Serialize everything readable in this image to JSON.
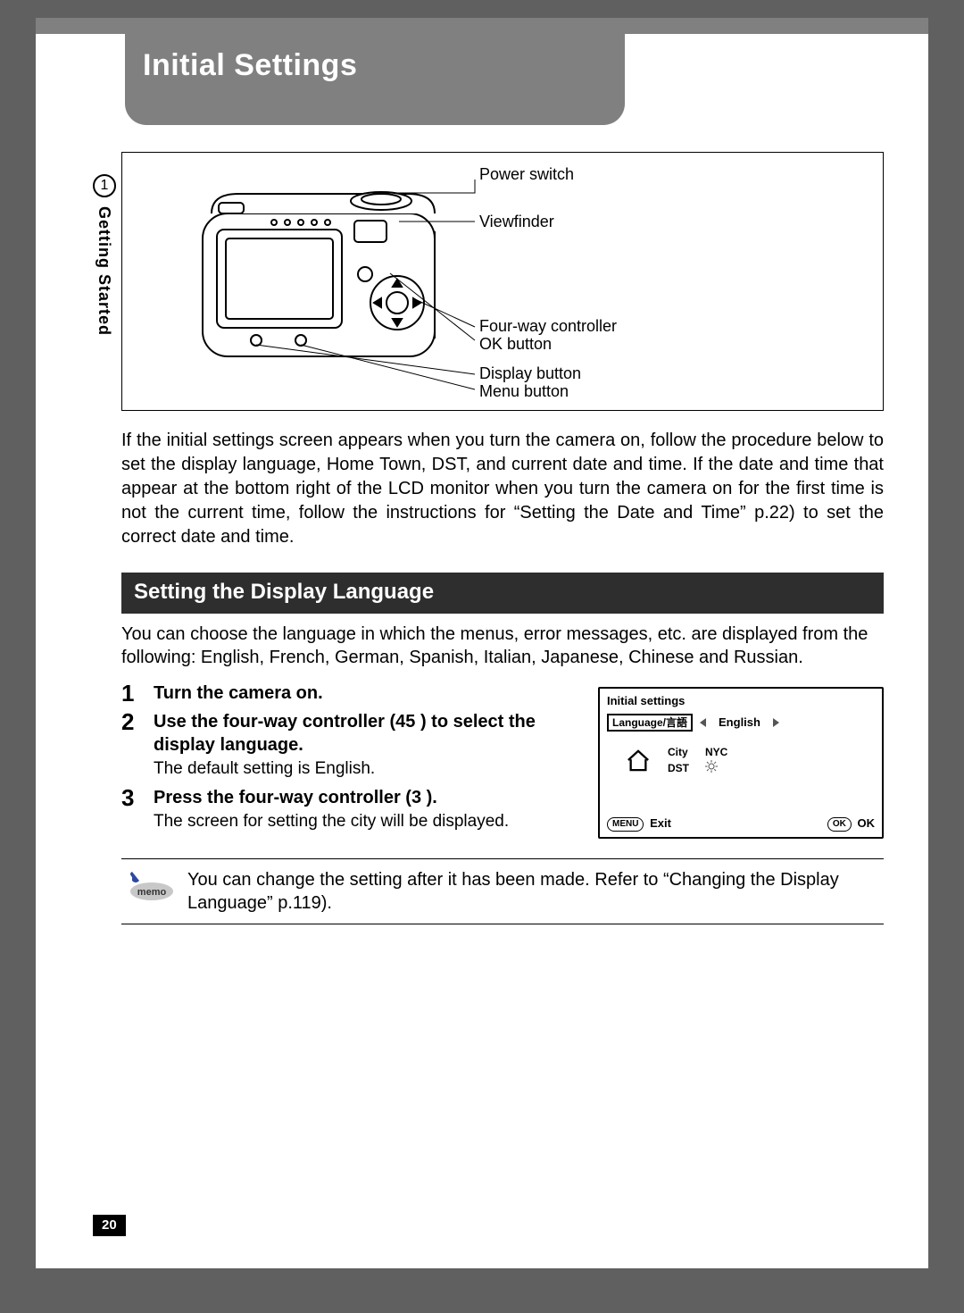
{
  "title": "Initial Settings",
  "side": {
    "number": "1",
    "label": "Getting Started"
  },
  "diagram": {
    "callouts": {
      "power": "Power switch",
      "viewfinder": "Viewfinder",
      "fourway": "Four-way controller",
      "ok": "OK button",
      "display": "Display button",
      "menu": "Menu button"
    }
  },
  "intro": "If the initial settings screen appears when you turn the camera on, follow the procedure below to set the display language, Home Town, DST, and current date and time. If the date and time that appear at the bottom right of the LCD monitor when you turn the camera on for the first time is not the current time, follow the instructions for “Setting the Date and Time” p.22) to set the correct date and time.",
  "section": {
    "heading": "Setting the Display Language",
    "intro": "You can choose the language in which the menus, error messages, etc. are displayed from the following: English, French, German, Spanish, Italian, Japanese, Chinese and Russian."
  },
  "steps": [
    {
      "num": "1",
      "title": "Turn the camera on.",
      "note": ""
    },
    {
      "num": "2",
      "title": "Use the four-way controller (45   ) to select the display language.",
      "note": "The default setting is English."
    },
    {
      "num": "3",
      "title": "Press the four-way controller (3  ).",
      "note": "The screen for setting the city will be displayed."
    }
  ],
  "lcd": {
    "title": "Initial settings",
    "lang_label": "Language/言語",
    "lang_value": "English",
    "city_label": "City",
    "city_value": "NYC",
    "dst_label": "DST",
    "menu_btn": "MENU",
    "exit": "Exit",
    "ok_btn": "OK",
    "ok": "OK"
  },
  "memo": "You can change the setting after it has been made. Refer to “Changing the Display Language” p.119).",
  "page_number": "20"
}
